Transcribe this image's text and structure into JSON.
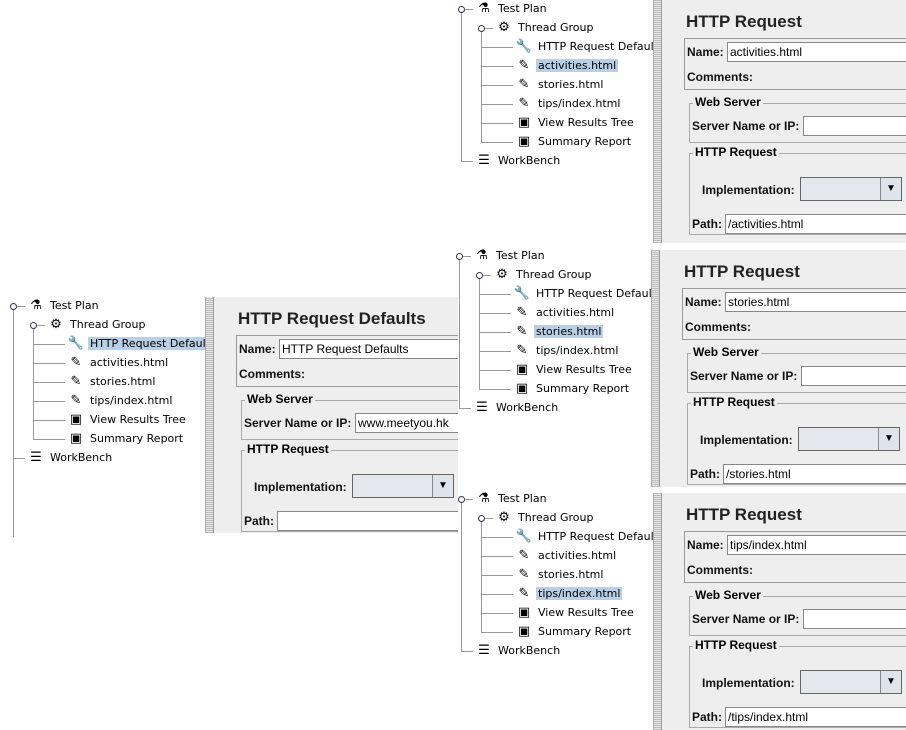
{
  "tree_labels": {
    "test_plan": "Test Plan",
    "thread_group": "Thread Group",
    "children": [
      "HTTP Request Defaults",
      "activities.html",
      "stories.html",
      "tips/index.html",
      "View Results Tree",
      "Summary Report"
    ],
    "workbench": "WorkBench"
  },
  "child_icons": [
    "config-element-icon",
    "sampler-pipette-icon",
    "sampler-pipette-icon",
    "sampler-pipette-icon",
    "listener-graph-icon",
    "listener-graph-icon"
  ],
  "form_labels": {
    "name": "Name:",
    "comments": "Comments:",
    "web_server": "Web Server",
    "server_name": "Server Name or IP:",
    "http_request": "HTTP Request",
    "implementation": "Implementation:",
    "path": "Path:"
  },
  "panels": [
    {
      "selected": 1,
      "title": "HTTP Request",
      "name_value": "activities.html",
      "server_value": "",
      "path_value": "/activities.html"
    },
    {
      "selected": 2,
      "title": "HTTP Request",
      "name_value": "stories.html",
      "server_value": "",
      "path_value": "/stories.html"
    },
    {
      "selected": 3,
      "title": "HTTP Request",
      "name_value": "tips/index.html",
      "server_value": "",
      "path_value": "/tips/index.html"
    },
    {
      "selected": 0,
      "title": "HTTP Request Defaults",
      "name_value": "HTTP Request Defaults",
      "server_value": "www.meetyou.hk",
      "path_value": ""
    }
  ],
  "colors": {
    "selection": "#b8cfe5",
    "panel_bg": "#eeeeee"
  }
}
